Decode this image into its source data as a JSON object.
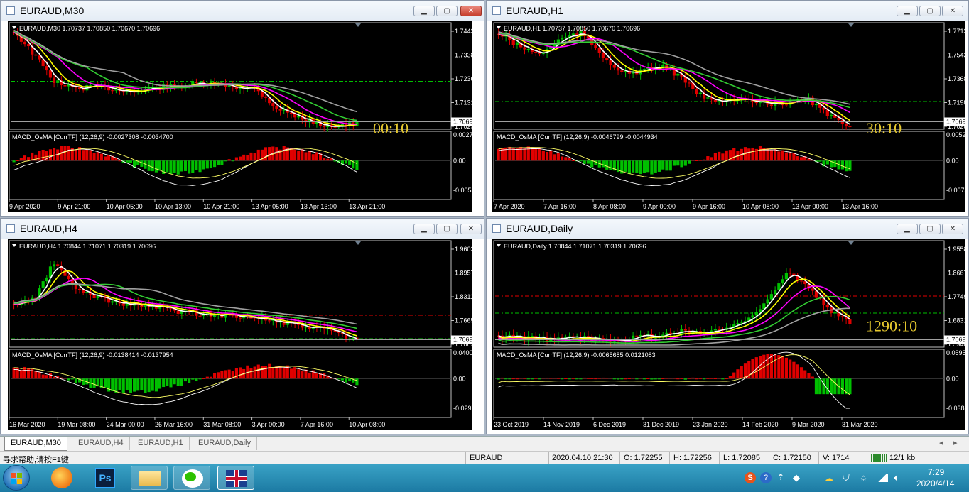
{
  "windows": [
    {
      "id": "m30",
      "title": "EURAUD,M30",
      "active": true,
      "info": "EURAUD,M30  1.70737 1.70850 1.70670 1.70696",
      "price_ticks": [
        "1.74430",
        "1.73380",
        "1.72360",
        "1.71310",
        "1.70290"
      ],
      "current_price": "1.70696",
      "timer": "00:10",
      "indicator": "MACD_OsMA [CurrTF] (12,26,9) -0.0027308 -0.0034700",
      "ind_ticks": [
        "0.0027683",
        "0.00",
        "-0.0055184"
      ],
      "time_labels": [
        "9 Apr 2020",
        "9 Apr 21:00",
        "10 Apr 05:00",
        "10 Apr 13:00",
        "10 Apr 21:00",
        "13 Apr 05:00",
        "13 Apr 13:00",
        "13 Apr 21:00"
      ]
    },
    {
      "id": "h1",
      "title": "EURAUD,H1",
      "active": false,
      "info": "EURAUD,H1  1.70737 1.70850 1.70670 1.70696",
      "price_ticks": [
        "1.77130",
        "1.75430",
        "1.73680",
        "1.71980",
        "1.70280"
      ],
      "current_price": "1.70696",
      "timer": "30:10",
      "indicator": "MACD_OsMA [CurrTF] (12,26,9) -0.0046799 -0.0044934",
      "ind_ticks": [
        "0.0052046",
        "0.00",
        "-0.0073713"
      ],
      "time_labels": [
        "7 Apr 2020",
        "7 Apr 16:00",
        "8 Apr 08:00",
        "9 Apr 00:00",
        "9 Apr 16:00",
        "10 Apr 08:00",
        "13 Apr 00:00",
        "13 Apr 16:00"
      ]
    },
    {
      "id": "h4",
      "title": "EURAUD,H4",
      "active": false,
      "info": "EURAUD,H4  1.70844 1.71071 1.70319 1.70696",
      "price_ticks": [
        "1.96030",
        "1.89570",
        "1.83110",
        "1.76650",
        "1.70696"
      ],
      "current_price": "1.70696",
      "timer": "",
      "indicator": "MACD_OsMA [CurrTF] (12,26,9) -0.0138414 -0.0137954",
      "ind_ticks": [
        "0.0400879",
        "0.00",
        "-0.0297657"
      ],
      "time_labels": [
        "16 Mar 2020",
        "19 Mar 08:00",
        "24 Mar 00:00",
        "26 Mar 16:00",
        "31 Mar 08:00",
        "3 Apr 00:00",
        "7 Apr 16:00",
        "10 Apr 08:00"
      ]
    },
    {
      "id": "daily",
      "title": "EURAUD,Daily",
      "active": false,
      "info": "EURAUD,Daily  1.70844 1.71071 1.70319 1.70696",
      "price_ticks": [
        "1.95580",
        "1.86670",
        "1.77490",
        "1.68310",
        "1.59400"
      ],
      "current_price": "1.70696",
      "timer": "1290:10",
      "indicator": "MACD_OsMA [CurrTF] (12,26,9) -0.0065685 0.0121083",
      "ind_ticks": [
        "0.0595038",
        "0.00",
        "-0.0388890"
      ],
      "time_labels": [
        "23 Oct 2019",
        "14 Nov 2019",
        "6 Dec 2019",
        "31 Dec 2019",
        "23 Jan 2020",
        "14 Feb 2020",
        "9 Mar 2020",
        "31 Mar 2020"
      ]
    }
  ],
  "tabs": [
    "EURAUD,M30",
    "EURAUD,H4",
    "EURAUD,H1",
    "EURAUD,Daily"
  ],
  "status": {
    "help": "寻求帮助,请按F1键",
    "symbol": "EURAUD",
    "datetime": "2020.04.10 21:30",
    "open": "O: 1.72255",
    "high": "H: 1.72256",
    "low": "L: 1.72085",
    "close": "C: 1.72150",
    "volume": "V: 1714",
    "traffic": "12/1 kb"
  },
  "taskbar": {
    "apps": [
      "start-orb",
      "browser",
      "photoshop",
      "file-explorer",
      "wechat",
      "metatrader"
    ],
    "ps_label": "Ps",
    "clock_time": "7:29",
    "clock_date": "2020/4/14"
  },
  "colors": {
    "bull": "#00c000",
    "bear": "#e00000",
    "ma_fast": "#ffffff",
    "ma_mid": "#ffff00",
    "ma_slow": "#ff00ff",
    "ma_green": "#32cd32",
    "ma_gray": "#a0a0a0"
  }
}
